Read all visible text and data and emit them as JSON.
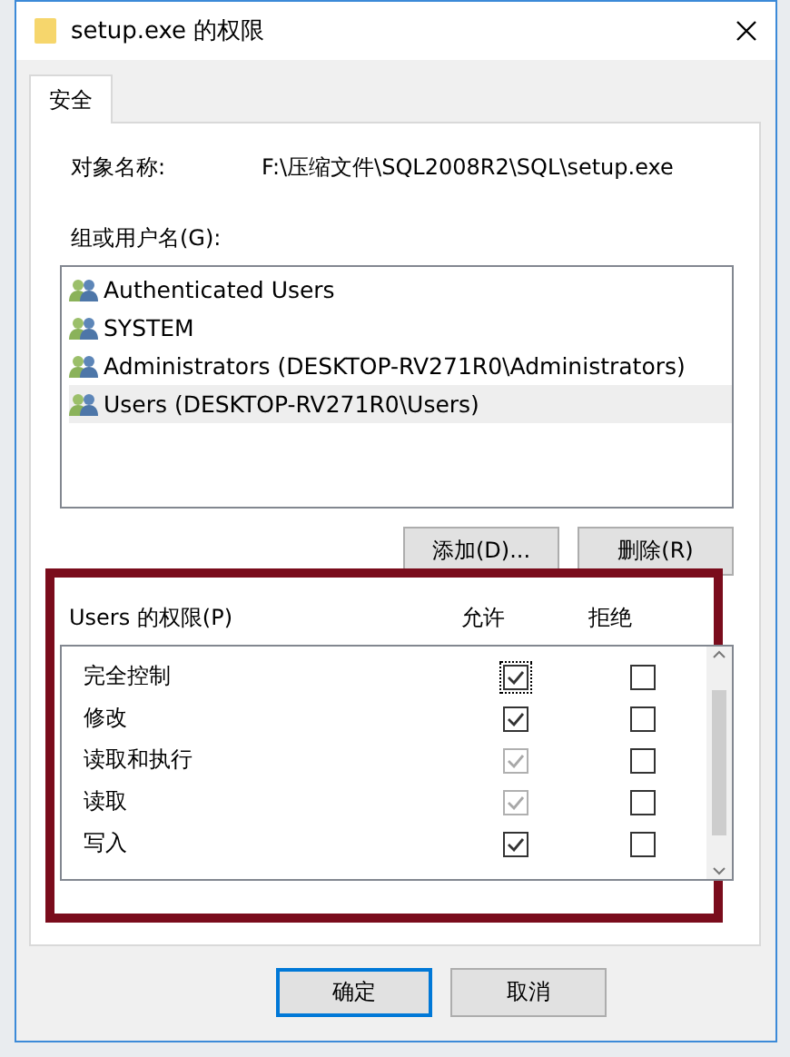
{
  "window": {
    "title": "setup.exe 的权限"
  },
  "tabs": [
    {
      "label": "安全",
      "selected": true
    }
  ],
  "object_name": {
    "label": "对象名称:",
    "value": "F:\\压缩文件\\SQL2008R2\\SQL\\setup.exe"
  },
  "groups": {
    "label": "组或用户名(G):",
    "items": [
      {
        "name": "Authenticated Users",
        "selected": false
      },
      {
        "name": "SYSTEM",
        "selected": false
      },
      {
        "name": "Administrators (DESKTOP-RV271R0\\Administrators)",
        "selected": false
      },
      {
        "name": "Users (DESKTOP-RV271R0\\Users)",
        "selected": true
      }
    ],
    "buttons": [
      "添加(D)...",
      "删除(R)"
    ]
  },
  "permissions": {
    "label": "Users 的权限(P)",
    "columns": [
      "允许",
      "拒绝"
    ],
    "rows": [
      {
        "name": "完全控制",
        "allow": true,
        "allow_disabled": false,
        "deny": false,
        "focused": true
      },
      {
        "name": "修改",
        "allow": true,
        "allow_disabled": false,
        "deny": false,
        "focused": false
      },
      {
        "name": "读取和执行",
        "allow": true,
        "allow_disabled": true,
        "deny": false,
        "focused": false
      },
      {
        "name": "读取",
        "allow": true,
        "allow_disabled": true,
        "deny": false,
        "focused": false
      },
      {
        "name": "写入",
        "allow": true,
        "allow_disabled": false,
        "deny": false,
        "focused": false
      }
    ]
  },
  "buttons": [
    {
      "label": "确定",
      "default": true
    },
    {
      "label": "取消",
      "default": false
    }
  ]
}
